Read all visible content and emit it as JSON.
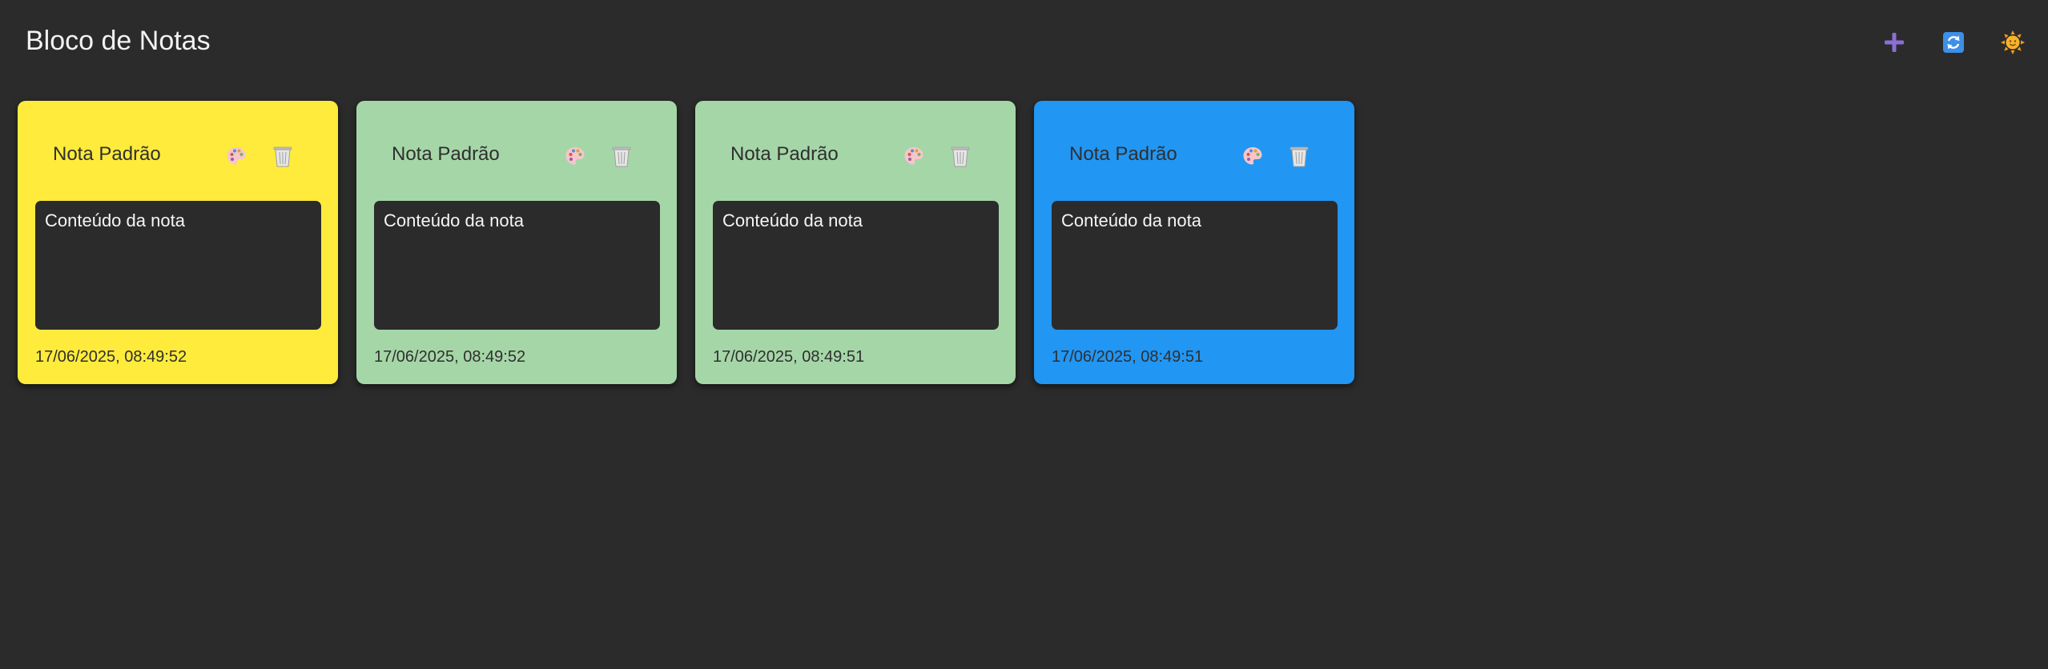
{
  "header": {
    "title": "Bloco de Notas",
    "actions": [
      {
        "name": "add",
        "icon": "plus-icon",
        "color": "#8b6fd6"
      },
      {
        "name": "refresh",
        "icon": "refresh-icon",
        "color": "#3d8fe8"
      },
      {
        "name": "theme",
        "icon": "sun-icon",
        "color": "#f29a1f"
      }
    ]
  },
  "colors": {
    "background": "#2b2b2b",
    "note_yellow": "#ffeb3b",
    "note_green": "#a5d6a7",
    "note_blue": "#2196f3"
  },
  "notes": [
    {
      "title": "Nota Padrão",
      "content": "Conteúdo da nota",
      "date": "17/06/2025, 08:49:52",
      "color": "#ffeb3b",
      "palette_icon": "palette-icon",
      "delete_icon": "trash-icon"
    },
    {
      "title": "Nota Padrão",
      "content": "Conteúdo da nota",
      "date": "17/06/2025, 08:49:52",
      "color": "#a5d6a7",
      "palette_icon": "palette-icon",
      "delete_icon": "trash-icon"
    },
    {
      "title": "Nota Padrão",
      "content": "Conteúdo da nota",
      "date": "17/06/2025, 08:49:51",
      "color": "#a5d6a7",
      "palette_icon": "palette-icon",
      "delete_icon": "trash-icon"
    },
    {
      "title": "Nota Padrão",
      "content": "Conteúdo da nota",
      "date": "17/06/2025, 08:49:51",
      "color": "#2196f3",
      "palette_icon": "palette-icon",
      "delete_icon": "trash-icon"
    }
  ]
}
